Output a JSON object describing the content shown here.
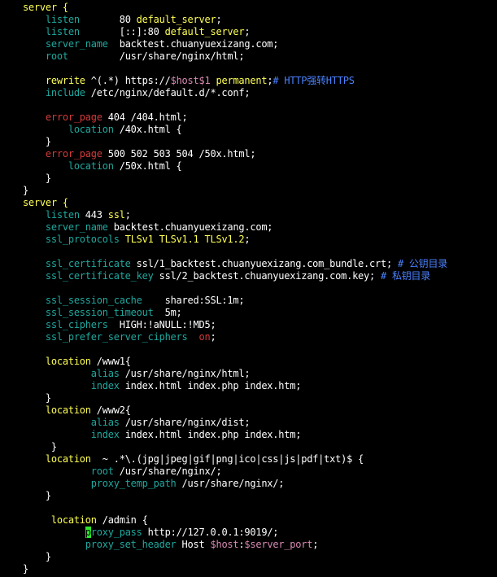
{
  "colors": {
    "background": "#000000",
    "default": "#ffffff",
    "block": "#ffff55",
    "directive": "#1fa89e",
    "value": "#ffff55",
    "error_directive": "#d23a3a",
    "comment": "#4a82ff",
    "variable": "#d98ab3",
    "on_value": "#d23a3a",
    "cursor": "#2ee82e"
  },
  "lines": [
    [
      [
        "    server {",
        "block"
      ]
    ],
    [
      [
        "        ",
        ""
      ],
      [
        "listen",
        "directive"
      ],
      [
        "       80 ",
        ""
      ],
      [
        "default_server",
        "value"
      ],
      [
        ";",
        ""
      ]
    ],
    [
      [
        "        ",
        ""
      ],
      [
        "listen",
        "directive"
      ],
      [
        "       [::]:80 ",
        ""
      ],
      [
        "default_server",
        "value"
      ],
      [
        ";",
        ""
      ]
    ],
    [
      [
        "        ",
        ""
      ],
      [
        "server_name",
        "directive"
      ],
      [
        "  backtest.chuanyuexizang.com;",
        ""
      ]
    ],
    [
      [
        "        ",
        ""
      ],
      [
        "root",
        "directive"
      ],
      [
        "         /usr/share/nginx/html;",
        ""
      ]
    ],
    [],
    [
      [
        "        ",
        ""
      ],
      [
        "rewrite",
        "value"
      ],
      [
        " ^(.*) https://",
        ""
      ],
      [
        "$host$1",
        "variable"
      ],
      [
        " ",
        ""
      ],
      [
        "permanent",
        "value"
      ],
      [
        ";",
        ""
      ],
      [
        "# HTTP强转HTTPS",
        "comment"
      ]
    ],
    [
      [
        "        ",
        ""
      ],
      [
        "include",
        "directive"
      ],
      [
        " /etc/nginx/default.d/*.conf;",
        ""
      ]
    ],
    [],
    [
      [
        "        ",
        ""
      ],
      [
        "error_page",
        "error_directive"
      ],
      [
        " 404 /404.html;",
        ""
      ]
    ],
    [
      [
        "            ",
        ""
      ],
      [
        "location",
        "directive"
      ],
      [
        " /40x.html {",
        ""
      ]
    ],
    [
      [
        "        }",
        ""
      ]
    ],
    [
      [
        "        ",
        ""
      ],
      [
        "error_page",
        "error_directive"
      ],
      [
        " 500 502 503 504 /50x.html;",
        ""
      ]
    ],
    [
      [
        "            ",
        ""
      ],
      [
        "location",
        "directive"
      ],
      [
        " /50x.html {",
        ""
      ]
    ],
    [
      [
        "        }",
        ""
      ]
    ],
    [
      [
        "    }",
        ""
      ]
    ],
    [
      [
        "    server {",
        "block"
      ]
    ],
    [
      [
        "        ",
        ""
      ],
      [
        "listen",
        "directive"
      ],
      [
        " 443 ",
        ""
      ],
      [
        "ssl",
        "value"
      ],
      [
        ";",
        ""
      ]
    ],
    [
      [
        "        ",
        ""
      ],
      [
        "server_name",
        "directive"
      ],
      [
        " backtest.chuanyuexizang.com;",
        ""
      ]
    ],
    [
      [
        "        ",
        ""
      ],
      [
        "ssl_protocols",
        "directive"
      ],
      [
        " ",
        ""
      ],
      [
        "TLSv1 TLSv1.1 TLSv1.2",
        "value"
      ],
      [
        ";",
        ""
      ]
    ],
    [],
    [
      [
        "        ",
        ""
      ],
      [
        "ssl_certificate",
        "directive"
      ],
      [
        " ssl/1_backtest.chuanyuexizang.com_bundle.crt; ",
        ""
      ],
      [
        "# 公钥目录",
        "comment"
      ]
    ],
    [
      [
        "        ",
        ""
      ],
      [
        "ssl_certificate_key",
        "directive"
      ],
      [
        " ssl/2_backtest.chuanyuexizang.com.key; ",
        ""
      ],
      [
        "# 私钥目录",
        "comment"
      ]
    ],
    [],
    [
      [
        "        ",
        ""
      ],
      [
        "ssl_session_cache",
        "directive"
      ],
      [
        "    shared:SSL:1m;",
        ""
      ]
    ],
    [
      [
        "        ",
        ""
      ],
      [
        "ssl_session_timeout",
        "directive"
      ],
      [
        "  5m;",
        ""
      ]
    ],
    [
      [
        "        ",
        ""
      ],
      [
        "ssl_ciphers",
        "directive"
      ],
      [
        "  HIGH:!aNULL:!MD5;",
        ""
      ]
    ],
    [
      [
        "        ",
        ""
      ],
      [
        "ssl_prefer_server_ciphers",
        "directive"
      ],
      [
        "  ",
        ""
      ],
      [
        "on",
        "on_value"
      ],
      [
        ";",
        ""
      ]
    ],
    [],
    [
      [
        "        ",
        ""
      ],
      [
        "location",
        "value"
      ],
      [
        " /www1{",
        ""
      ]
    ],
    [
      [
        "                ",
        ""
      ],
      [
        "alias",
        "directive"
      ],
      [
        " /usr/share/nginx/html;",
        ""
      ]
    ],
    [
      [
        "                ",
        ""
      ],
      [
        "index",
        "directive"
      ],
      [
        " index.html index.php index.htm;",
        ""
      ]
    ],
    [
      [
        "        }",
        ""
      ]
    ],
    [
      [
        "        ",
        ""
      ],
      [
        "location",
        "value"
      ],
      [
        " /www2{",
        ""
      ]
    ],
    [
      [
        "                ",
        ""
      ],
      [
        "alias",
        "directive"
      ],
      [
        " /usr/share/nginx/dist;",
        ""
      ]
    ],
    [
      [
        "                ",
        ""
      ],
      [
        "index",
        "directive"
      ],
      [
        " index.html index.php index.htm;",
        ""
      ]
    ],
    [
      [
        "         }",
        ""
      ]
    ],
    [
      [
        "        ",
        ""
      ],
      [
        "location",
        "value"
      ],
      [
        "  ~ .*\\.(jpg|jpeg|gif|png|ico|css|js|pdf|txt)$ {",
        ""
      ]
    ],
    [
      [
        "                ",
        ""
      ],
      [
        "root",
        "directive"
      ],
      [
        " /usr/share/nginx/;",
        ""
      ]
    ],
    [
      [
        "                ",
        ""
      ],
      [
        "proxy_temp_path",
        "directive"
      ],
      [
        " /usr/share/nginx/;",
        ""
      ]
    ],
    [
      [
        "        }",
        ""
      ]
    ],
    [],
    [
      [
        "         ",
        ""
      ],
      [
        "location",
        "value"
      ],
      [
        " /admin {",
        ""
      ]
    ],
    [
      [
        "               ",
        ""
      ],
      [
        "p",
        "cursor"
      ],
      [
        "roxy_pass",
        "directive"
      ],
      [
        " http://127.0.0.1:9019/;",
        ""
      ]
    ],
    [
      [
        "               ",
        ""
      ],
      [
        "proxy_set_header",
        "directive"
      ],
      [
        " Host ",
        ""
      ],
      [
        "$host",
        "variable"
      ],
      [
        ":",
        ""
      ],
      [
        "$server_port",
        "variable"
      ],
      [
        ";",
        ""
      ]
    ],
    [
      [
        "        }",
        ""
      ]
    ],
    [
      [
        "    }",
        ""
      ]
    ]
  ]
}
